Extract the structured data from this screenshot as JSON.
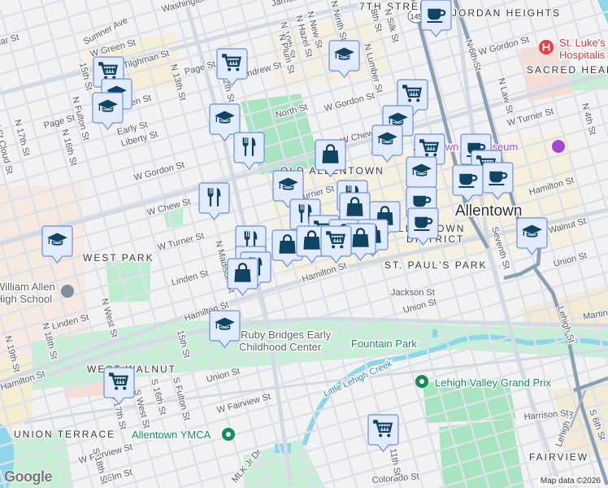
{
  "neighborhoods": {
    "seventh_street": "7TH STREE",
    "jordan_heights": "JORDAN HEIGHTS",
    "sacred_heart": "SACRED HEAR",
    "old_allentown": "OLD ALLENTOWN",
    "west_park": "WEST PARK",
    "st_pauls_park": "ST. PAUL'S PARK",
    "west_walnut": "WEST WALNUT",
    "union_terrace": "UNION TERRACE",
    "fairview": "FAIRVIEW",
    "district_line1": "ALLENTOWN",
    "district_line2": "DISTRICT"
  },
  "city": "Allentown",
  "pois": {
    "hospital_line1": "St. Luke's",
    "hospital_line2": "Hospitalis",
    "art_museum": "Allentown Art Museum",
    "high_school_line1": "William Allen",
    "high_school_line2": "High School",
    "ruby_line1": "Ruby Bridges Early",
    "ruby_line2": "Childhood Center",
    "fountain_park": "Fountain Park",
    "grand_prix": "Lehigh Valley Grand Prix",
    "ymca": "Allentown YMCA",
    "creek": "Little Lehigh Creek"
  },
  "route_shield": "145",
  "streets": {
    "sumner": "Sumner Ave",
    "washington": "Washington",
    "james": "James",
    "green": "W Green St",
    "tilghman": "W Tilghman St",
    "cedar": "Cedar St",
    "fifteenth": "15th St",
    "n13th": "N 13th St",
    "page1": "Page St",
    "page2": "Page St",
    "andrew": "Andrew St",
    "n12th": "N 12th St",
    "n10th": "N 10th St",
    "plum": "N Plum St",
    "hazel": "N Hazel St",
    "new": "N New St",
    "ninth": "N Ninth St",
    "eighth": "8th St",
    "silk": "N Silk St",
    "lumber": "N Lumber St",
    "north": "North St",
    "gordon1": "W Gordon St",
    "gordon2": "W Gordon St",
    "gordon3": "W Gordon St",
    "early": "Early St",
    "liberty": "Liberty St",
    "allen": "Allen St",
    "chew1": "W Chew St",
    "chew2": "W Chew St",
    "turner1": "W Turner St",
    "turner2": "W Turner St",
    "turner3": "W Turner St",
    "n17th": "N 17th St",
    "n16th": "N 16th St",
    "fulton": "N Fulton St",
    "cloud": "N St Cloud St",
    "n6th": "N 6th St",
    "law": "N Law St",
    "n4th": "N 4th St",
    "hamilton1": "Hamilton St",
    "hamilton2": "Hamilton St",
    "hamilton3": "Hamilton St",
    "hamilton4": "Hamilton St",
    "walnut": "Walnut St",
    "union1": "Union St",
    "union2": "Union St",
    "union3": "Union St",
    "linden1": "Linden St",
    "linden2": "Linden St",
    "madison": "N Madison St",
    "westst": "N West St",
    "n18th": "N 18th St",
    "n19th": "N 19th St",
    "s15th": "15th St",
    "s16th": "S 16th St",
    "sfulton": "S Fulton St",
    "swest": "S West St",
    "s17th": "S 17th St",
    "fairview1": "W Fairview St",
    "fairview2": "W Fairview St",
    "elm": "Elm St",
    "s18th": "S 18th St",
    "jackson": "Jackson St",
    "seventh": "Seventh St",
    "lehigh1": "Lehigh St",
    "lehigh2": "Lehigh St",
    "s6th": "S 6th St",
    "harrison": "Harrison St",
    "colorado": "Colorado St",
    "s11th": "11th St",
    "martin": "Martin",
    "mlk": "MLK Jr Dr"
  },
  "markers": [
    {
      "icon": "cart"
    },
    {
      "icon": "school"
    },
    {
      "icon": "school"
    },
    {
      "icon": "cart"
    },
    {
      "icon": "school"
    },
    {
      "icon": "school"
    },
    {
      "icon": "food"
    },
    {
      "icon": "coffee"
    },
    {
      "icon": "cart"
    },
    {
      "icon": "school"
    },
    {
      "icon": "school"
    },
    {
      "icon": "cart"
    },
    {
      "icon": "shop"
    },
    {
      "icon": "school"
    },
    {
      "icon": "food"
    },
    {
      "icon": "coffee"
    },
    {
      "icon": "cart"
    },
    {
      "icon": "coffee"
    },
    {
      "icon": "coffee"
    },
    {
      "icon": "school"
    },
    {
      "icon": "food"
    },
    {
      "icon": "shop"
    },
    {
      "icon": "coffee"
    },
    {
      "icon": "coffee"
    },
    {
      "icon": "food"
    },
    {
      "icon": "shop"
    },
    {
      "icon": "cart"
    },
    {
      "icon": "shop"
    },
    {
      "icon": "shop"
    },
    {
      "icon": "shop"
    },
    {
      "icon": "food"
    },
    {
      "icon": "shop"
    },
    {
      "icon": "shop"
    },
    {
      "icon": "cart"
    },
    {
      "icon": "food"
    },
    {
      "icon": "food"
    },
    {
      "icon": "shop"
    },
    {
      "icon": "school"
    },
    {
      "icon": "school"
    },
    {
      "icon": "school"
    },
    {
      "icon": "cart"
    },
    {
      "icon": "cart"
    }
  ],
  "colors": {
    "marker_fill": "#e2ebfb",
    "marker_stroke": "#6b8fd8",
    "marker_icon": "#0f4463",
    "park": "#a8e4bf",
    "water": "#8fd6ea",
    "highway": "#8a9fb8"
  },
  "footer": {
    "logo": "Google",
    "attribution": "Map data ©2026"
  }
}
